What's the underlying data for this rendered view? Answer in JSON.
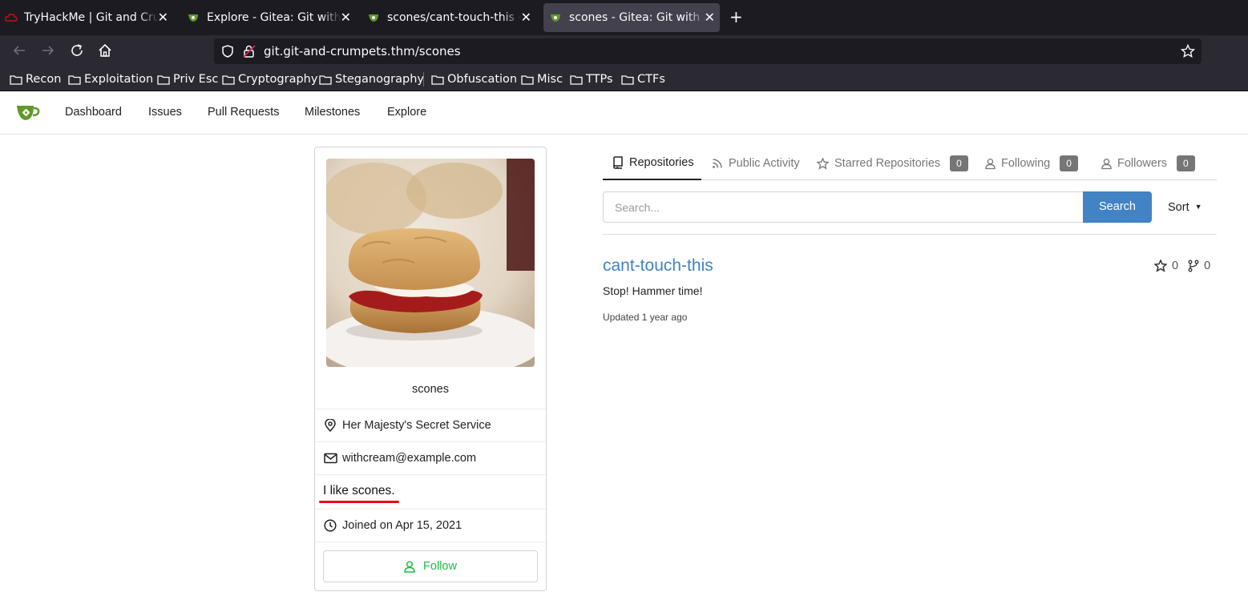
{
  "browser": {
    "tabs": [
      {
        "title": "TryHackMe | Git and Crumpets",
        "active": false
      },
      {
        "title": "Explore - Gitea: Git with a cup of tea",
        "active": false
      },
      {
        "title": "scones/cant-touch-this - Gitea",
        "active": false
      },
      {
        "title": "scones - Gitea: Git with a cup of tea",
        "active": true
      }
    ],
    "url": "git.git-and-crumpets.thm/scones",
    "bookmarks": [
      "Recon",
      "Exploitation",
      "Priv Esc",
      "Cryptography",
      "Steganography",
      "Obfuscation",
      "Misc",
      "TTPs",
      "CTFs"
    ]
  },
  "gitea_nav": {
    "items": [
      "Dashboard",
      "Issues",
      "Pull Requests",
      "Milestones",
      "Explore"
    ]
  },
  "profile": {
    "username": "scones",
    "location": "Her Majesty's Secret Service",
    "email": "withcream@example.com",
    "bio": "I like scones.",
    "joined": "Joined on Apr 15, 2021",
    "follow_label": "Follow"
  },
  "profile_tabs": {
    "repositories": "Repositories",
    "public_activity": "Public Activity",
    "starred": "Starred Repositories",
    "starred_count": "0",
    "following": "Following",
    "following_count": "0",
    "followers": "Followers",
    "followers_count": "0"
  },
  "search": {
    "placeholder": "Search...",
    "button": "Search",
    "sort": "Sort"
  },
  "repos": [
    {
      "name": "cant-touch-this",
      "description": "Stop! Hammer time!",
      "updated": "Updated 1 year ago",
      "stars": "0",
      "forks": "0"
    }
  ],
  "colors": {
    "accent": "#4183c4",
    "follow_green": "#21ba45",
    "annotation_red": "#e8081c"
  }
}
